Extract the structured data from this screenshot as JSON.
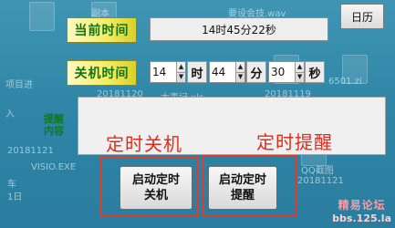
{
  "labels": {
    "current_time": "当前时间",
    "shutdown_time": "关机时间",
    "remind_content_line1": "提醒",
    "remind_content_line2": "内容"
  },
  "current_time_display": "14时45分22秒",
  "calendar_button": "日历",
  "shutdown": {
    "hour": "14",
    "hour_unit": "时",
    "minute": "44",
    "minute_unit": "分",
    "second": "30",
    "second_unit": "秒"
  },
  "captions": {
    "timed_shutdown": "定时关机",
    "timed_reminder": "定时提醒"
  },
  "buttons": {
    "start_shutdown_line1": "启动定时",
    "start_shutdown_line2": "关机",
    "start_reminder_line1": "启动定时",
    "start_reminder_line2": "提醒"
  },
  "watermark": {
    "line1": "精易论坛",
    "line2": "bbs.125.la"
  },
  "desktop_ghost_text": [
    "副本",
    "要设会技.wav",
    "项目进",
    "20181120",
    "大事记.xls",
    "6501.zi",
    "20181119",
    "入",
    "20181121",
    "VISIO.EXE",
    "车",
    "1日",
    "QQ截图",
    "20181121"
  ]
}
